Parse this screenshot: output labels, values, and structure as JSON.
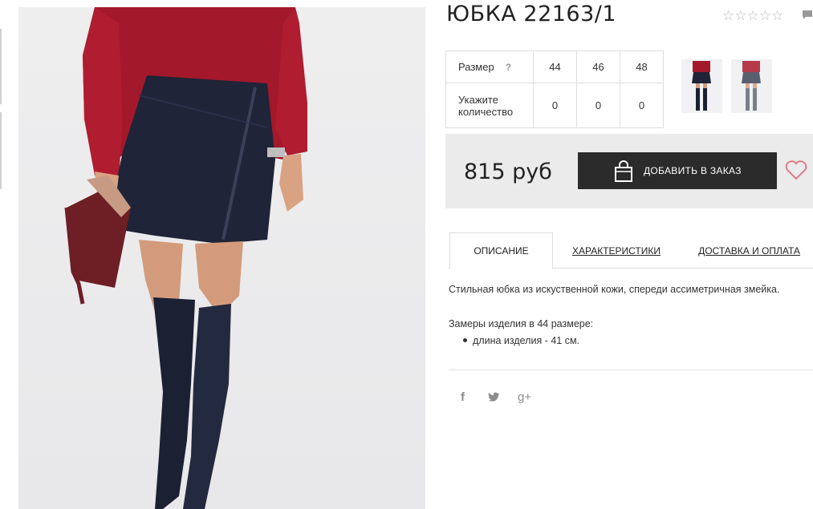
{
  "product": {
    "title": "ЮБКА 22163/1",
    "rating_stars": "☆☆☆☆☆"
  },
  "sizes": {
    "size_label": "Размер",
    "help_icon": "?",
    "quantity_label_line1": "Укажите",
    "quantity_label_line2": "количество",
    "options": [
      {
        "size": "44",
        "qty": "0"
      },
      {
        "size": "46",
        "qty": "0"
      },
      {
        "size": "48",
        "qty": "0"
      }
    ]
  },
  "thumbnails": [
    "thumb-front",
    "thumb-back"
  ],
  "purchase": {
    "price": "815 руб",
    "order_button": "ДОБАВИТЬ В ЗАКАЗ",
    "bag_icon": "shopping-bag-icon",
    "wishlist_icon": "heart-icon"
  },
  "tabs": [
    {
      "label": "ОПИСАНИЕ",
      "active": true
    },
    {
      "label": "ХАРАКТЕРИСТИКИ",
      "active": false
    },
    {
      "label": "ДОСТАВКА И ОПЛАТА",
      "active": false
    }
  ],
  "description": {
    "text": "Стильная юбка из искуственной кожи, спереди ассиметричная змейка.",
    "measurements_title": "Замеры изделия в 44 размере:",
    "measurements": [
      "длина изделия - 41 см."
    ]
  },
  "social": {
    "facebook": "f",
    "twitter": "twitter-icon",
    "googleplus": "g+"
  },
  "colors": {
    "dark_button": "#2b2b2b",
    "heart": "#e07a86",
    "price_box": "#ebebeb"
  }
}
